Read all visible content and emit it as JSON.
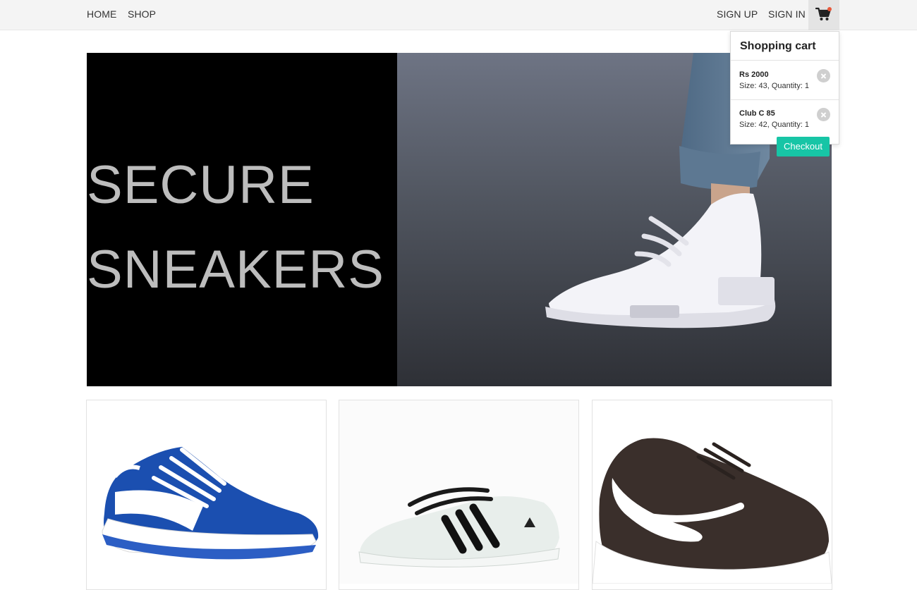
{
  "nav": {
    "home": "HOME",
    "shop": "SHOP",
    "sign_up": "SIGN UP",
    "sign_in": "SIGN IN",
    "cart_icon": "shopping-cart-icon"
  },
  "hero": {
    "line1": "SECURE",
    "line2": "SNEAKERS",
    "photo": "white-sneaker-on-asphalt"
  },
  "products": [
    {
      "image": "blue-reebok-sneaker"
    },
    {
      "image": "white-adidas-sneaker"
    },
    {
      "image": "black-nike-sneaker"
    }
  ],
  "cart": {
    "title": "Shopping cart",
    "items": [
      {
        "name": "Rs 2000",
        "meta": "Size: 43, Quantity: 1"
      },
      {
        "name": "Club C 85",
        "meta": "Size: 42, Quantity: 1"
      }
    ],
    "checkout_label": "Checkout"
  },
  "colors": {
    "accent": "#17c5a6",
    "hero_bg": "#000000",
    "hero_text": "#bdbdbd",
    "badge": "#e8583a"
  }
}
